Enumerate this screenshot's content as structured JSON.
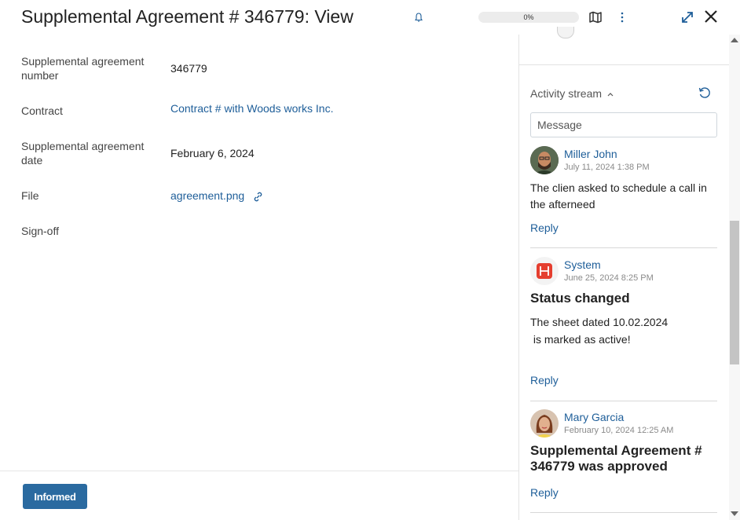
{
  "header": {
    "title": "Supplemental Agreement # 346779: View",
    "progress": "0%",
    "icons": [
      "bell-icon",
      "map-icon",
      "more-icon",
      "expand-icon",
      "close-icon"
    ]
  },
  "fields": [
    {
      "label": "Supplemental agreement number",
      "value": "346779"
    },
    {
      "label": "Contract",
      "value": "Contract # with Woods works Inc."
    },
    {
      "label": "Supplemental agreement date",
      "value": "February 6, 2024"
    },
    {
      "label": "File",
      "value": "agreement.png"
    },
    {
      "label": "Sign-off",
      "value": ""
    }
  ],
  "footer": {
    "informed_label": "Informed"
  },
  "activity": {
    "title": "Activity stream",
    "message_placeholder": "Message",
    "posts": [
      {
        "author": "Miller John",
        "timestamp": "July 11, 2024 1:38 PM",
        "heading": "",
        "text": "The clien asked to schedule a call in the afterneed",
        "reply": "Reply"
      },
      {
        "author": "System",
        "timestamp": "June 25, 2024 8:25 PM",
        "heading": "Status changed",
        "text_line1": "The sheet dated 10.02.2024",
        "text_line2": " is marked as active!",
        "reply": "Reply"
      },
      {
        "author": "Mary Garcia",
        "timestamp": "February 10, 2024 12:25 AM",
        "heading": "Supplemental Agreement # 346779 was approved",
        "reply": "Reply"
      }
    ]
  },
  "colors": {
    "accent": "#2a6aa0",
    "link": "#1e5e99",
    "system_icon": "#e53e2f"
  }
}
